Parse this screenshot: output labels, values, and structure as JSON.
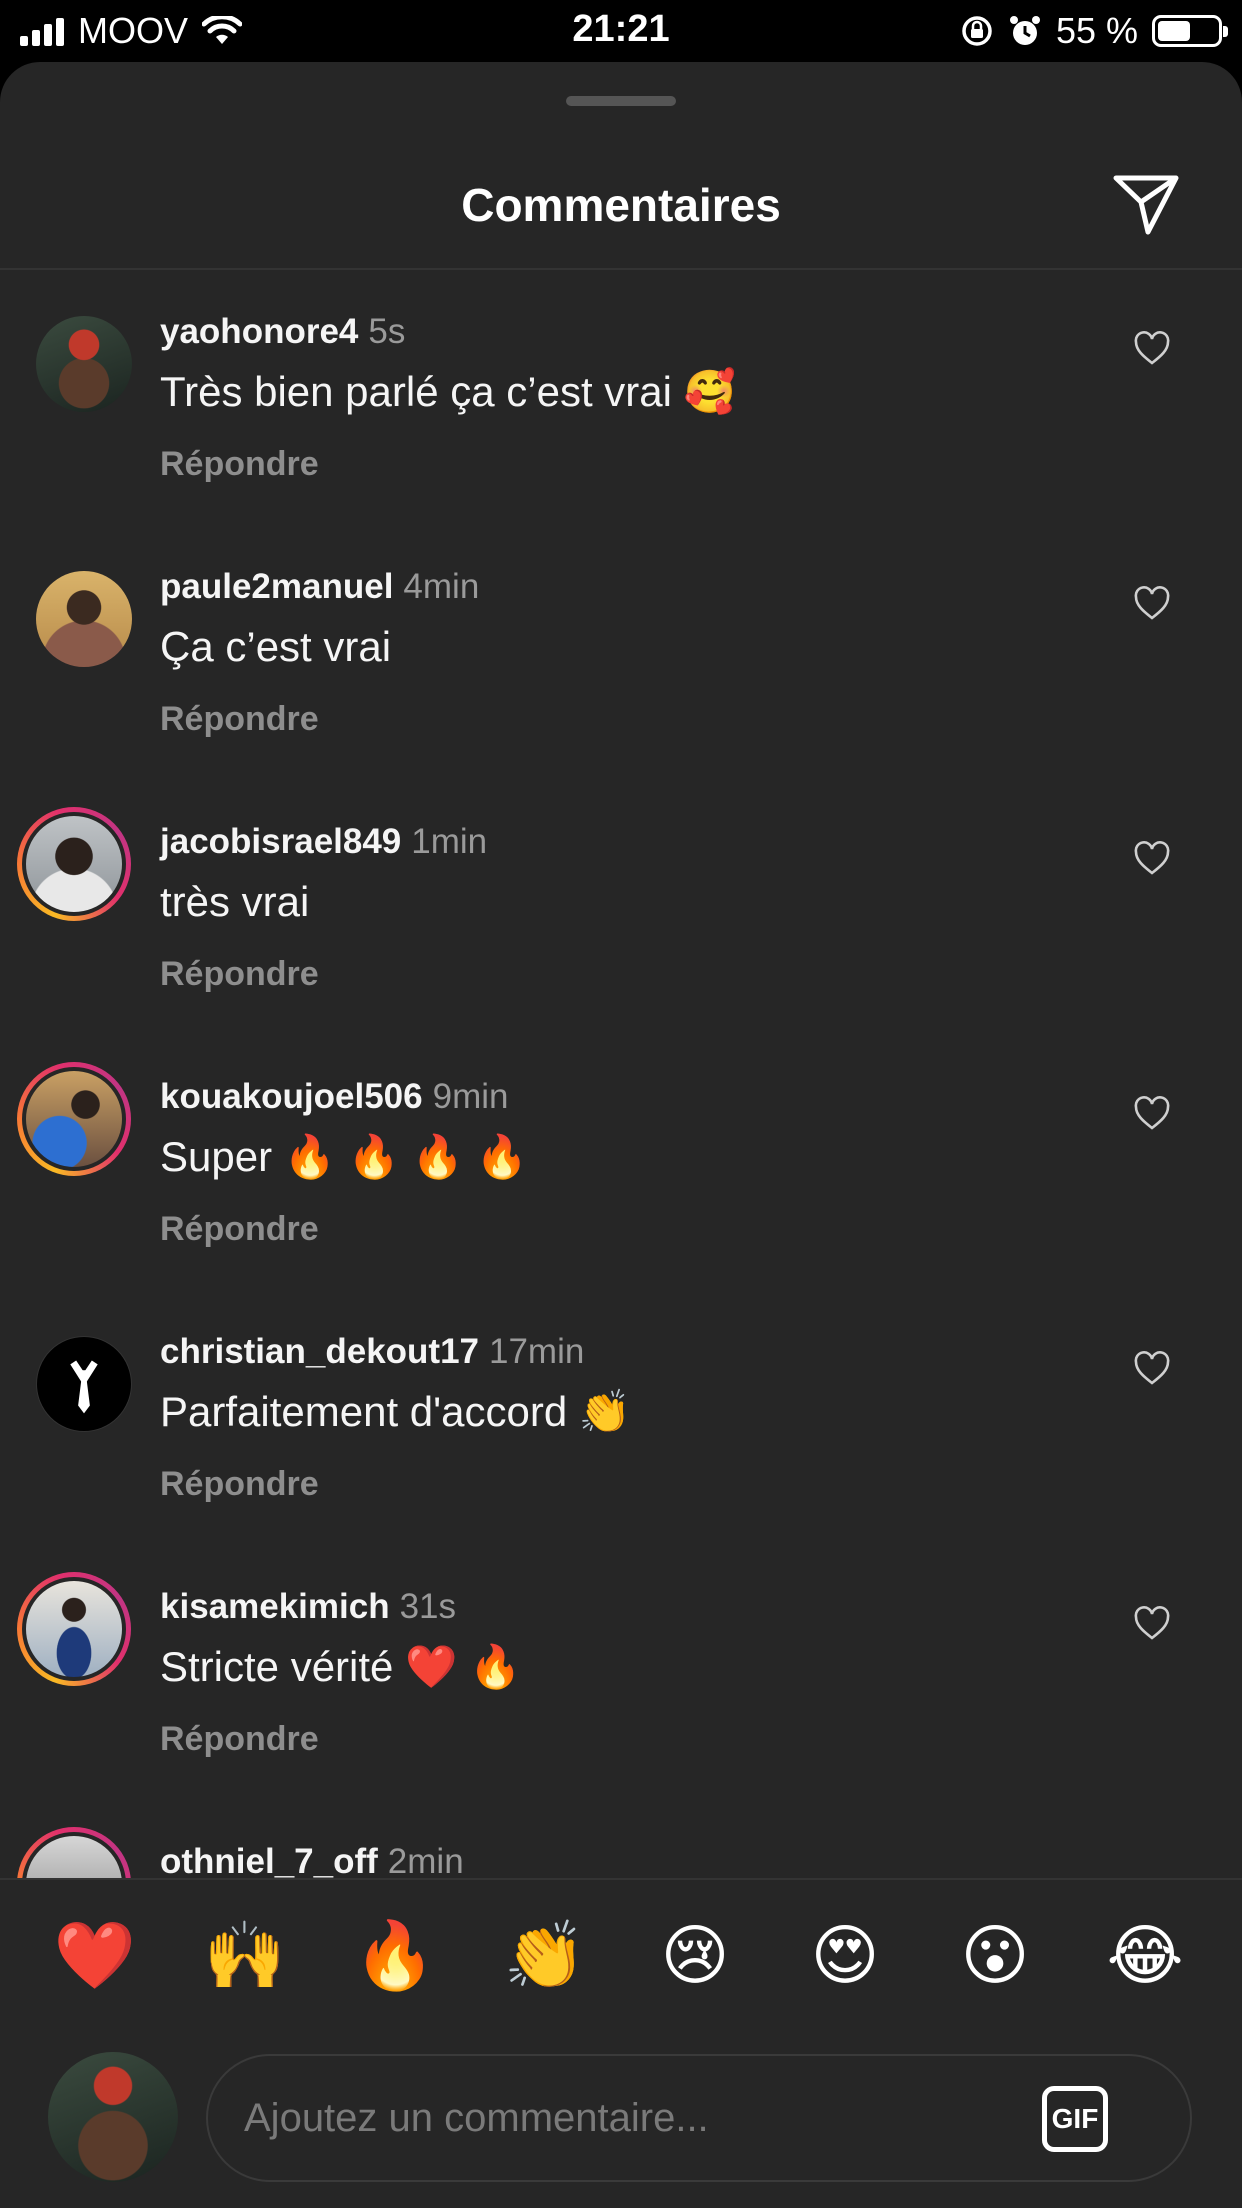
{
  "status_bar": {
    "carrier": "MOOV",
    "time": "21:21",
    "battery": "55 %",
    "battery_level": 0.55,
    "icons": [
      "signal-icon",
      "wifi-icon",
      "orientation-lock-icon",
      "alarm-icon",
      "battery-icon"
    ]
  },
  "header": {
    "title": "Commentaires",
    "send_icon": "send-icon"
  },
  "comments": [
    {
      "username": "yaohonore4",
      "time": "5s",
      "text": "Très bien parlé ça c’est vrai 🥰",
      "reply": "Répondre",
      "story_ring": false
    },
    {
      "username": "paule2manuel",
      "time": "4min",
      "text": "Ça c’est vrai",
      "reply": "Répondre",
      "story_ring": false
    },
    {
      "username": "jacobisrael849",
      "time": "1min",
      "text": "très vrai",
      "reply": "Répondre",
      "story_ring": true
    },
    {
      "username": "kouakoujoel506",
      "time": "9min",
      "text": "Super 🔥 🔥 🔥 🔥",
      "reply": "Répondre",
      "story_ring": true
    },
    {
      "username": "christian_dekout17",
      "time": "17min",
      "text": "Parfaitement d'accord 👏",
      "reply": "Répondre",
      "story_ring": false
    },
    {
      "username": "kisamekimich",
      "time": "31s",
      "text": "Stricte vérité ❤️ 🔥",
      "reply": "Répondre",
      "story_ring": true
    },
    {
      "username": "othniel_7_off",
      "time": "2min",
      "text": "",
      "reply": "",
      "story_ring": true
    }
  ],
  "quick_reactions": [
    "❤️",
    "🙌",
    "🔥",
    "👏",
    "😢",
    "😍",
    "😮",
    "😂"
  ],
  "composer": {
    "placeholder": "Ajoutez un commentaire...",
    "gif_label": "GIF"
  },
  "colors": {
    "background": "#262626",
    "text": "#f5f5f5",
    "muted": "#8e8e8e"
  }
}
